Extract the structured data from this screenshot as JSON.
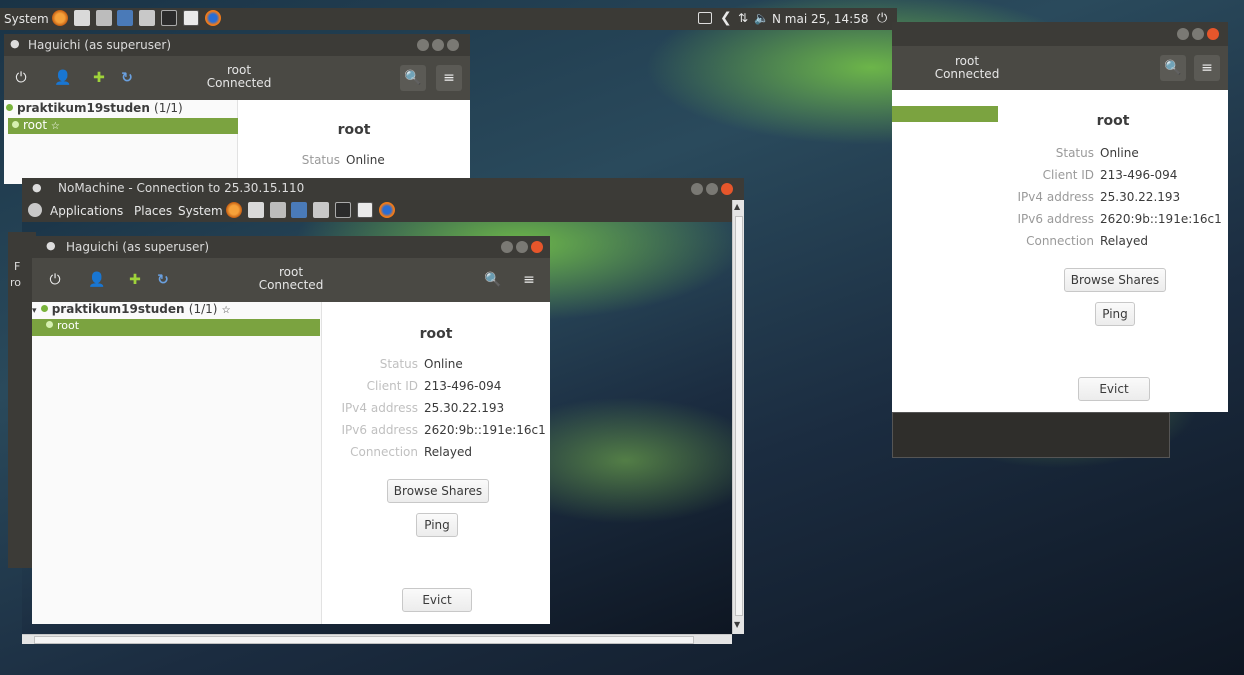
{
  "top_panel": {
    "menu_system": "System",
    "clock": "N mai  25, 14:58",
    "colors": {
      "panel": "#3b3a36"
    }
  },
  "win_top": {
    "title": "Haguichi (as superuser)",
    "header_user": "root",
    "header_status": "Connected",
    "network_name": "praktikum19studen",
    "network_count": "(1/1)",
    "member": "root",
    "detail_name": "root",
    "status_label": "Status",
    "status_value": "Online"
  },
  "win_right": {
    "header_user": "root",
    "header_status": "Connected",
    "detail_name": "root",
    "fields": [
      {
        "label": "Status",
        "value": "Online"
      },
      {
        "label": "Client ID",
        "value": "213-496-094"
      },
      {
        "label": "IPv4 address",
        "value": "25.30.22.193"
      },
      {
        "label": "IPv6 address",
        "value": "2620:9b::191e:16c1"
      },
      {
        "label": "Connection",
        "value": "Relayed"
      }
    ],
    "browse_label": "Browse Shares",
    "ping_label": "Ping",
    "evict_label": "Evict"
  },
  "nomachine": {
    "title": "NoMachine - Connection to 25.30.15.110",
    "menu_applications": "Applications",
    "menu_places": "Places",
    "menu_system": "System"
  },
  "inner": {
    "title": "Haguichi (as superuser)",
    "header_user": "root",
    "header_status": "Connected",
    "network_name": "praktikum19studen",
    "network_count": "(1/1)",
    "member": "root",
    "detail_name": "root",
    "fields": [
      {
        "label": "Status",
        "value": "Online"
      },
      {
        "label": "Client ID",
        "value": "213-496-094"
      },
      {
        "label": "IPv4 address",
        "value": "25.30.22.193"
      },
      {
        "label": "IPv6 address",
        "value": "2620:9b::191e:16c1"
      },
      {
        "label": "Connection",
        "value": "Relayed"
      }
    ],
    "browse_label": "Browse Shares",
    "ping_label": "Ping",
    "evict_label": "Evict"
  },
  "partial_left": {
    "letter1": "F",
    "letter2": "ro"
  }
}
